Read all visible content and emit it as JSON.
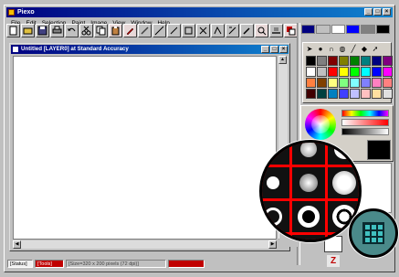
{
  "window": {
    "title": "Piexo"
  },
  "menu": [
    "File",
    "Edit",
    "Selection",
    "Paint",
    "Image",
    "View",
    "Window",
    "Help"
  ],
  "toolbar": {
    "buttons": [
      "new",
      "open",
      "save",
      "print",
      "undo",
      "cut",
      "copy",
      "paste",
      "pencil",
      "brush",
      "line",
      "rect",
      "ellipse",
      "text",
      "fill",
      "eyedropper",
      "zoom"
    ]
  },
  "document": {
    "title": "Untitled [LAYER0] at Standard Accuracy"
  },
  "status_bar": {
    "segments": [
      "[Status]",
      "[Tools]",
      "[Size=320 x 200 pixels (72 dpi)]",
      ""
    ]
  },
  "colors": {
    "accent_title": "#000080",
    "palette": [
      "#000000",
      "#808080",
      "#800000",
      "#808000",
      "#008000",
      "#008080",
      "#000080",
      "#800080",
      "#ffffff",
      "#c0c0c0",
      "#ff0000",
      "#ffff00",
      "#00ff00",
      "#00ffff",
      "#0000ff",
      "#ff00ff",
      "#ff8040",
      "#804000",
      "#ffff80",
      "#80ff80",
      "#80ffff",
      "#8080ff",
      "#ff80c0",
      "#ff8080",
      "#400000",
      "#004040",
      "#0080c0",
      "#4040ff",
      "#c0c0ff",
      "#ffc0c0",
      "#ffe0a0",
      "#e0e0e0"
    ],
    "current": "#000000"
  },
  "bottom_indicator": "Z"
}
